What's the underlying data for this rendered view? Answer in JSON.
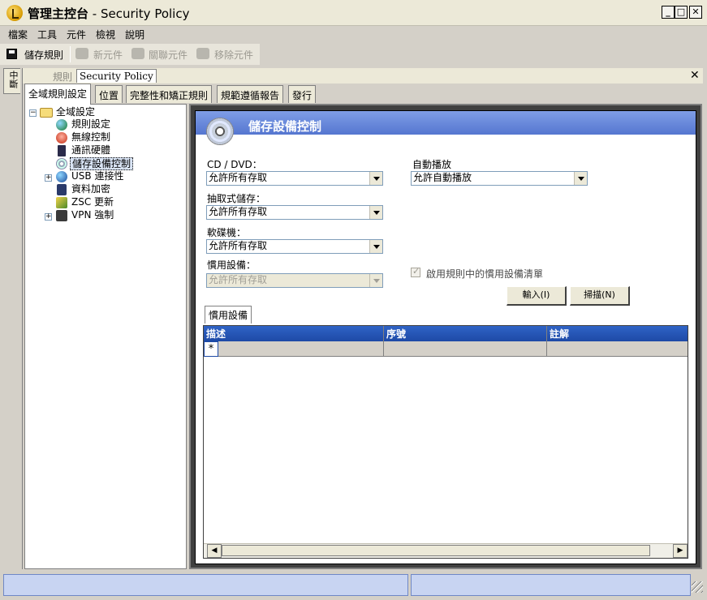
{
  "window": {
    "title_main": "管理主控台",
    "title_sub": " - Security Policy",
    "minimize_label": "_",
    "maximize_label": "□",
    "close_label": "✕"
  },
  "menu": [
    "檔案",
    "工具",
    "元件",
    "檢視",
    "說明"
  ],
  "toolbar": {
    "save_label": "儲存規則",
    "new_component_label": "新元件",
    "link_component_label": "關聯元件",
    "remove_component_label": "移除元件"
  },
  "side_tab": {
    "label": "中斷"
  },
  "document": {
    "tab_rule_label": "規則",
    "tab_policy_label": "Security Policy",
    "close_label": "✕"
  },
  "tabs": [
    "全域規則設定",
    "位置",
    "完整性和矯正規則",
    "規範遵循報告",
    "發行"
  ],
  "tree": {
    "root": "全域設定",
    "items": [
      "規則設定",
      "無線控制",
      "通訊硬體",
      "儲存設備控制",
      "USB 連接性",
      "資料加密",
      "ZSC 更新",
      "VPN 強制"
    ],
    "selected": "儲存設備控制"
  },
  "pane": {
    "title": "儲存設備控制",
    "cd_label": "CD / DVD：",
    "cd_value": "允許所有存取",
    "removable_label": "抽取式儲存：",
    "removable_value": "允許所有存取",
    "floppy_label": "軟碟機：",
    "floppy_value": "允許所有存取",
    "preferred_label": "慣用設備：",
    "preferred_value": "允許所有存取",
    "autoplay_label": "自動播放",
    "autoplay_value": "允許自動播放",
    "enable_list_label": "啟用規則中的慣用設備清單",
    "import_button": "輸入(I)",
    "scan_button": "掃描(N)",
    "subtab_label": "慣用設備"
  },
  "grid": {
    "columns": [
      "描述",
      "序號",
      "註解"
    ],
    "new_row_marker": "*"
  },
  "scrollbar": {
    "left_arrow": "◀",
    "right_arrow": "▶"
  },
  "colors": {
    "pane_header": "#5576d0",
    "grid_header": "#1e4aa6",
    "status_panel": "#c8d4f2"
  }
}
